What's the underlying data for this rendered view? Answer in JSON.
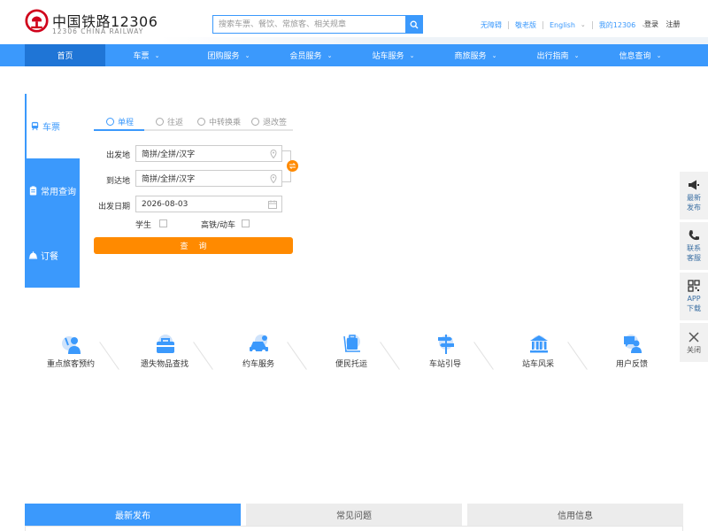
{
  "header": {
    "brand_cn": "中国铁路12306",
    "brand_en": "12306 CHINA RAILWAY",
    "search_placeholder": "搜索车票、餐饮、常旅客、相关规章",
    "links": [
      "无障碍",
      "敬老版",
      "English",
      "我的12306"
    ],
    "login": "登录",
    "register": "注册"
  },
  "nav": {
    "items": [
      {
        "label": "首页",
        "active": true
      },
      {
        "label": "车票",
        "dropdown": true
      },
      {
        "label": "团购服务",
        "dropdown": true
      },
      {
        "label": "会员服务",
        "dropdown": true
      },
      {
        "label": "站车服务",
        "dropdown": true
      },
      {
        "label": "商旅服务",
        "dropdown": true
      },
      {
        "label": "出行指南",
        "dropdown": true
      },
      {
        "label": "信息查询",
        "dropdown": true
      }
    ]
  },
  "booking": {
    "side_tabs": [
      "车票",
      "常用查询",
      "订餐"
    ],
    "trip_types": [
      "单程",
      "往返",
      "中转换乘",
      "退改签"
    ],
    "from_label": "出发地",
    "from_value": "简拼/全拼/汉字",
    "to_label": "到达地",
    "to_value": "简拼/全拼/汉字",
    "date_label": "出发日期",
    "date_value": "2026-08-03",
    "student_label": "学生",
    "gaotie_label": "高铁/动车",
    "query_label": "查询"
  },
  "services": [
    "重点旅客预约",
    "遗失物品查找",
    "约车服务",
    "便民托运",
    "车站引导",
    "站车风采",
    "用户反馈"
  ],
  "float": {
    "items": [
      {
        "line1": "最新",
        "line2": "发布"
      },
      {
        "line1": "联系",
        "line2": "客服"
      },
      {
        "line1": "APP",
        "line2": "下载"
      }
    ],
    "close": "关闭"
  },
  "bottom_tabs": [
    "最新发布",
    "常见问题",
    "信用信息"
  ],
  "colors": {
    "primary": "#3b99fc",
    "nav_active": "#1f75d6",
    "accent_orange": "#ff8a00",
    "brand_red": "#d0021b"
  },
  "icons": {
    "logo": "railway-logo-icon",
    "search": "search-icon",
    "pin": "location-pin-icon",
    "calendar": "calendar-icon",
    "swap": "swap-icon"
  }
}
